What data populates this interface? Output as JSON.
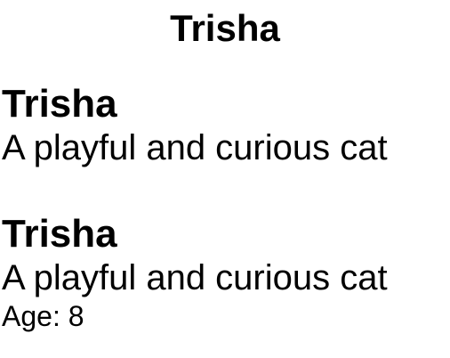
{
  "navigation": {
    "title": "Trisha"
  },
  "cards": [
    {
      "name": "Trisha",
      "description": "A playful and curious cat"
    },
    {
      "name": "Trisha",
      "description": "A playful and curious cat",
      "age_label": "Age: 8"
    }
  ]
}
